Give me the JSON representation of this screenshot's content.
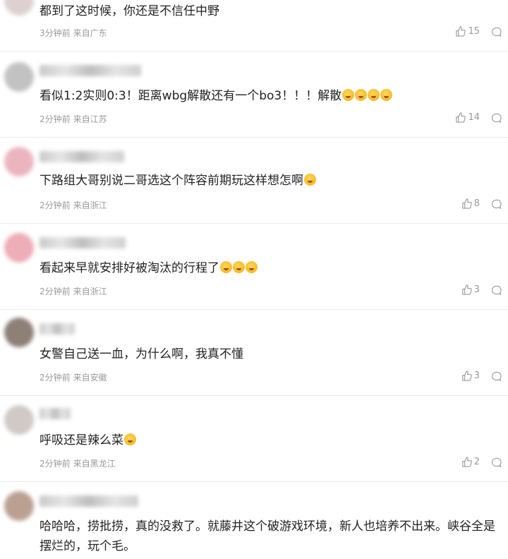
{
  "comments": [
    {
      "text": "都到了这时候，你还是不信任中野",
      "emojis": [],
      "time": "3分钟前",
      "location": "来自广东",
      "likes": "15",
      "avatar_color": "#d9c8c8"
    },
    {
      "text": "看似1:2实则0:3！距离wbg解散还有一个bo3！！！解散",
      "emojis": [
        "cry-face-emoji",
        "cry-face-emoji",
        "cry-face-emoji",
        "cry-face-emoji"
      ],
      "time": "2分钟前",
      "location": "来自江苏",
      "likes": "14",
      "avatar_color": "#b8b8b8"
    },
    {
      "text": "下路组大哥别说二哥选这个阵容前期玩这样想怎啊",
      "emojis": [
        "surprised-face-emoji"
      ],
      "time": "2分钟前",
      "location": "来自浙江",
      "likes": "8",
      "avatar_color": "#e8a8b4"
    },
    {
      "text": "看起来早就安排好被淘汰的行程了",
      "emojis": [
        "shocked-face-emoji",
        "shocked-face-emoji",
        "shocked-face-emoji"
      ],
      "time": "2分钟前",
      "location": "来自浙江",
      "likes": "3",
      "avatar_color": "#eaa0ac"
    },
    {
      "text": "女警自己送一血，为什么啊，我真不懂",
      "emojis": [],
      "time": "2分钟前",
      "location": "来自安徽",
      "likes": "3",
      "avatar_color": "#7a6a60"
    },
    {
      "text": "呼吸还是辣么菜",
      "emojis": [
        "sweat-face-emoji"
      ],
      "time": "2分钟前",
      "location": "来自黑龙江",
      "likes": "2",
      "avatar_color": "#c8c0bc"
    },
    {
      "text": "哈哈哈，捞批捞，真的没救了。就藤井这个破游戏环境，新人也培养不出来。峡谷全是摆烂的，玩个毛。",
      "emojis": [],
      "time": "",
      "location": "",
      "likes": "",
      "avatar_color": "#b09080"
    }
  ]
}
